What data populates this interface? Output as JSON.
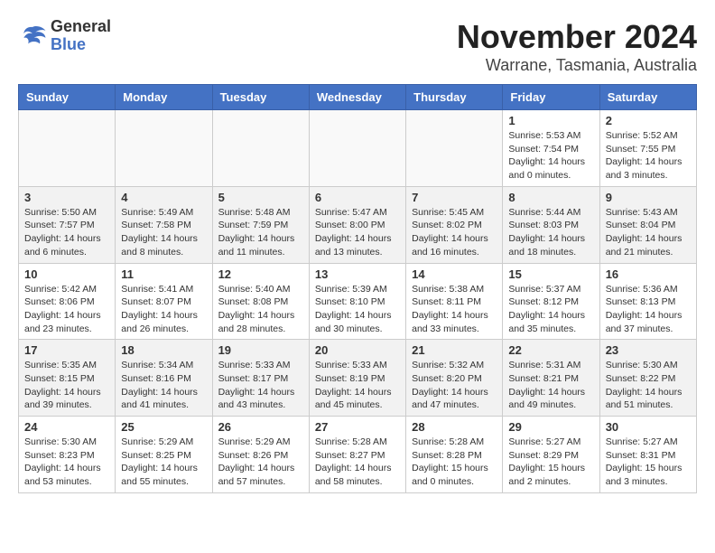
{
  "header": {
    "logo_general": "General",
    "logo_blue": "Blue",
    "month": "November 2024",
    "location": "Warrane, Tasmania, Australia"
  },
  "weekdays": [
    "Sunday",
    "Monday",
    "Tuesday",
    "Wednesday",
    "Thursday",
    "Friday",
    "Saturday"
  ],
  "weeks": [
    [
      {
        "day": "",
        "detail": ""
      },
      {
        "day": "",
        "detail": ""
      },
      {
        "day": "",
        "detail": ""
      },
      {
        "day": "",
        "detail": ""
      },
      {
        "day": "",
        "detail": ""
      },
      {
        "day": "1",
        "detail": "Sunrise: 5:53 AM\nSunset: 7:54 PM\nDaylight: 14 hours\nand 0 minutes."
      },
      {
        "day": "2",
        "detail": "Sunrise: 5:52 AM\nSunset: 7:55 PM\nDaylight: 14 hours\nand 3 minutes."
      }
    ],
    [
      {
        "day": "3",
        "detail": "Sunrise: 5:50 AM\nSunset: 7:57 PM\nDaylight: 14 hours\nand 6 minutes."
      },
      {
        "day": "4",
        "detail": "Sunrise: 5:49 AM\nSunset: 7:58 PM\nDaylight: 14 hours\nand 8 minutes."
      },
      {
        "day": "5",
        "detail": "Sunrise: 5:48 AM\nSunset: 7:59 PM\nDaylight: 14 hours\nand 11 minutes."
      },
      {
        "day": "6",
        "detail": "Sunrise: 5:47 AM\nSunset: 8:00 PM\nDaylight: 14 hours\nand 13 minutes."
      },
      {
        "day": "7",
        "detail": "Sunrise: 5:45 AM\nSunset: 8:02 PM\nDaylight: 14 hours\nand 16 minutes."
      },
      {
        "day": "8",
        "detail": "Sunrise: 5:44 AM\nSunset: 8:03 PM\nDaylight: 14 hours\nand 18 minutes."
      },
      {
        "day": "9",
        "detail": "Sunrise: 5:43 AM\nSunset: 8:04 PM\nDaylight: 14 hours\nand 21 minutes."
      }
    ],
    [
      {
        "day": "10",
        "detail": "Sunrise: 5:42 AM\nSunset: 8:06 PM\nDaylight: 14 hours\nand 23 minutes."
      },
      {
        "day": "11",
        "detail": "Sunrise: 5:41 AM\nSunset: 8:07 PM\nDaylight: 14 hours\nand 26 minutes."
      },
      {
        "day": "12",
        "detail": "Sunrise: 5:40 AM\nSunset: 8:08 PM\nDaylight: 14 hours\nand 28 minutes."
      },
      {
        "day": "13",
        "detail": "Sunrise: 5:39 AM\nSunset: 8:10 PM\nDaylight: 14 hours\nand 30 minutes."
      },
      {
        "day": "14",
        "detail": "Sunrise: 5:38 AM\nSunset: 8:11 PM\nDaylight: 14 hours\nand 33 minutes."
      },
      {
        "day": "15",
        "detail": "Sunrise: 5:37 AM\nSunset: 8:12 PM\nDaylight: 14 hours\nand 35 minutes."
      },
      {
        "day": "16",
        "detail": "Sunrise: 5:36 AM\nSunset: 8:13 PM\nDaylight: 14 hours\nand 37 minutes."
      }
    ],
    [
      {
        "day": "17",
        "detail": "Sunrise: 5:35 AM\nSunset: 8:15 PM\nDaylight: 14 hours\nand 39 minutes."
      },
      {
        "day": "18",
        "detail": "Sunrise: 5:34 AM\nSunset: 8:16 PM\nDaylight: 14 hours\nand 41 minutes."
      },
      {
        "day": "19",
        "detail": "Sunrise: 5:33 AM\nSunset: 8:17 PM\nDaylight: 14 hours\nand 43 minutes."
      },
      {
        "day": "20",
        "detail": "Sunrise: 5:33 AM\nSunset: 8:19 PM\nDaylight: 14 hours\nand 45 minutes."
      },
      {
        "day": "21",
        "detail": "Sunrise: 5:32 AM\nSunset: 8:20 PM\nDaylight: 14 hours\nand 47 minutes."
      },
      {
        "day": "22",
        "detail": "Sunrise: 5:31 AM\nSunset: 8:21 PM\nDaylight: 14 hours\nand 49 minutes."
      },
      {
        "day": "23",
        "detail": "Sunrise: 5:30 AM\nSunset: 8:22 PM\nDaylight: 14 hours\nand 51 minutes."
      }
    ],
    [
      {
        "day": "24",
        "detail": "Sunrise: 5:30 AM\nSunset: 8:23 PM\nDaylight: 14 hours\nand 53 minutes."
      },
      {
        "day": "25",
        "detail": "Sunrise: 5:29 AM\nSunset: 8:25 PM\nDaylight: 14 hours\nand 55 minutes."
      },
      {
        "day": "26",
        "detail": "Sunrise: 5:29 AM\nSunset: 8:26 PM\nDaylight: 14 hours\nand 57 minutes."
      },
      {
        "day": "27",
        "detail": "Sunrise: 5:28 AM\nSunset: 8:27 PM\nDaylight: 14 hours\nand 58 minutes."
      },
      {
        "day": "28",
        "detail": "Sunrise: 5:28 AM\nSunset: 8:28 PM\nDaylight: 15 hours\nand 0 minutes."
      },
      {
        "day": "29",
        "detail": "Sunrise: 5:27 AM\nSunset: 8:29 PM\nDaylight: 15 hours\nand 2 minutes."
      },
      {
        "day": "30",
        "detail": "Sunrise: 5:27 AM\nSunset: 8:31 PM\nDaylight: 15 hours\nand 3 minutes."
      }
    ]
  ]
}
